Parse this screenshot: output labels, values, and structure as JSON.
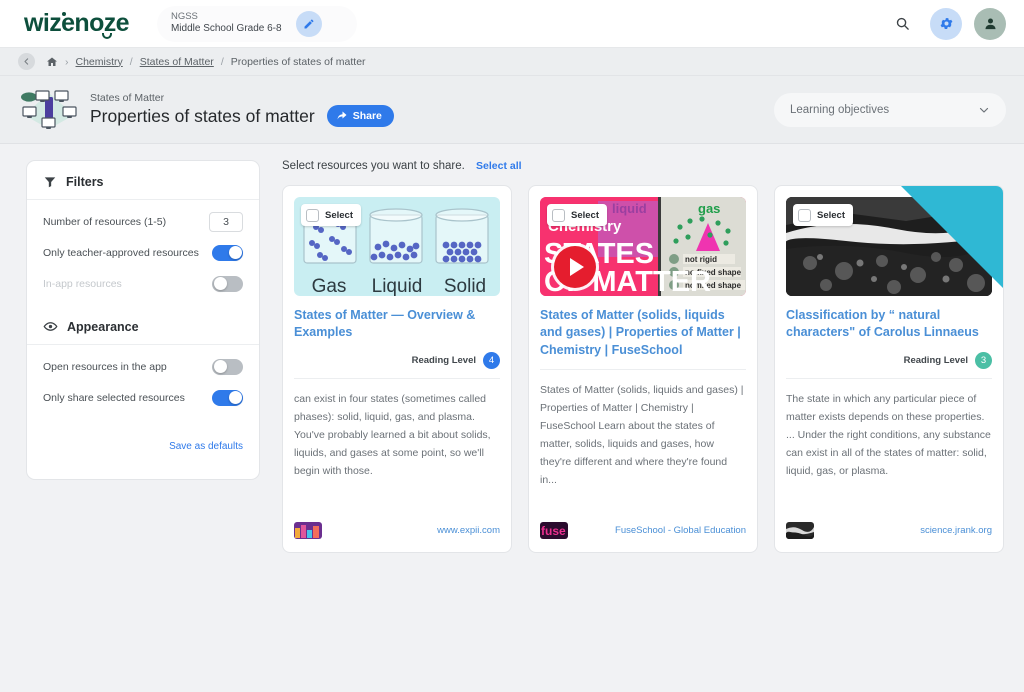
{
  "brand": {
    "name": "wizenoze"
  },
  "topbar": {
    "curriculum": {
      "standard": "NGSS",
      "level": "Middle School Grade 6-8",
      "edit_icon": "pencil-icon"
    },
    "actions": [
      {
        "name": "search-button",
        "icon": "search-icon"
      },
      {
        "name": "settings-button",
        "icon": "gear-icon"
      },
      {
        "name": "account-button",
        "icon": "user-icon"
      }
    ]
  },
  "breadcrumb": {
    "back_icon": "back-arrow-icon",
    "home_icon": "home-icon",
    "items": [
      "Chemistry",
      "States of Matter",
      "Properties of states of matter"
    ],
    "separator": "/"
  },
  "title_band": {
    "icon": "network-topic-icon",
    "supertitle": "States of Matter",
    "title": "Properties of states of matter",
    "share_label": "Share",
    "share_icon": "share-arrow-icon",
    "learning_objectives_label": "Learning objectives",
    "chevron_icon": "chevron-down-icon"
  },
  "filters_panel": {
    "filters_icon": "funnel-icon",
    "filters_title": "Filters",
    "number_of_resources_label": "Number of resources (1-5)",
    "number_of_resources_value": "3",
    "teacher_approved_label": "Only teacher-approved resources",
    "teacher_approved_state": "on",
    "in_app_label": "In-app resources",
    "in_app_state": "off",
    "appearance_icon": "eye-icon",
    "appearance_title": "Appearance",
    "open_in_app_label": "Open resources in the app",
    "open_in_app_state": "off",
    "only_selected_label": "Only share selected resources",
    "only_selected_state": "on",
    "save_defaults_label": "Save as defaults"
  },
  "results": {
    "heading": "Select resources you want to share.",
    "select_all_label": "Select all",
    "select_chip_label": "Select",
    "reading_level_label": "Reading Level",
    "cards": [
      {
        "name": "resource-card-states-of-matter-overview",
        "thumb_type": "illustration",
        "thumb_labels": [
          "Gas",
          "Liquid",
          "Solid"
        ],
        "title": "States of Matter — Overview & Examples",
        "has_reading_level": true,
        "reading_level": "4",
        "reading_level_color": "#2f7aea",
        "body": "can exist in four states (sometimes called phases): solid, liquid, gas, and plasma. You've probably learned a bit about solids, liquids, and gases at some point, so we'll begin with those.",
        "source": "www.expii.com",
        "teacher_approved": false
      },
      {
        "name": "resource-card-fuseschool-video",
        "thumb_type": "video",
        "thumb_text": [
          "Chemistry",
          "STATES",
          "OF MATTER"
        ],
        "thumb_side_text": [
          "liquid",
          "gas",
          "not rigid",
          "no fixed shape",
          "no fixed shape and volume"
        ],
        "title": "States of Matter (solids, liquids and gases) | Properties of Matter | Chemistry | FuseSchool",
        "has_reading_level": false,
        "reading_level": "",
        "reading_level_color": "",
        "body": "States of Matter (solids, liquids and gases) | Properties of Matter | Chemistry | FuseSchool Learn about the states of matter, solids, liquids and gases, how they're different and where they're found in...",
        "source": "FuseSchool - Global Education",
        "teacher_approved": false
      },
      {
        "name": "resource-card-linnaeus-classification",
        "thumb_type": "photo",
        "title": "Classification by “ natural characters\" of Carolus Linnaeus",
        "has_reading_level": true,
        "reading_level": "3",
        "reading_level_color": "#4bbfa5",
        "body": "The state in which any particular piece of matter exists depends on these properties. ... Under the right conditions, any substance can exist in all of the states of matter: solid, liquid, gas, or plasma.",
        "source": "science.jrank.org",
        "teacher_approved": true,
        "badge_icon": "teacher-approved-icon"
      }
    ]
  },
  "colors": {
    "accent_blue": "#2f7aea",
    "brand_green": "#0d4f3c",
    "teal": "#2fb8d4",
    "link_blue": "#4a8fd6"
  }
}
